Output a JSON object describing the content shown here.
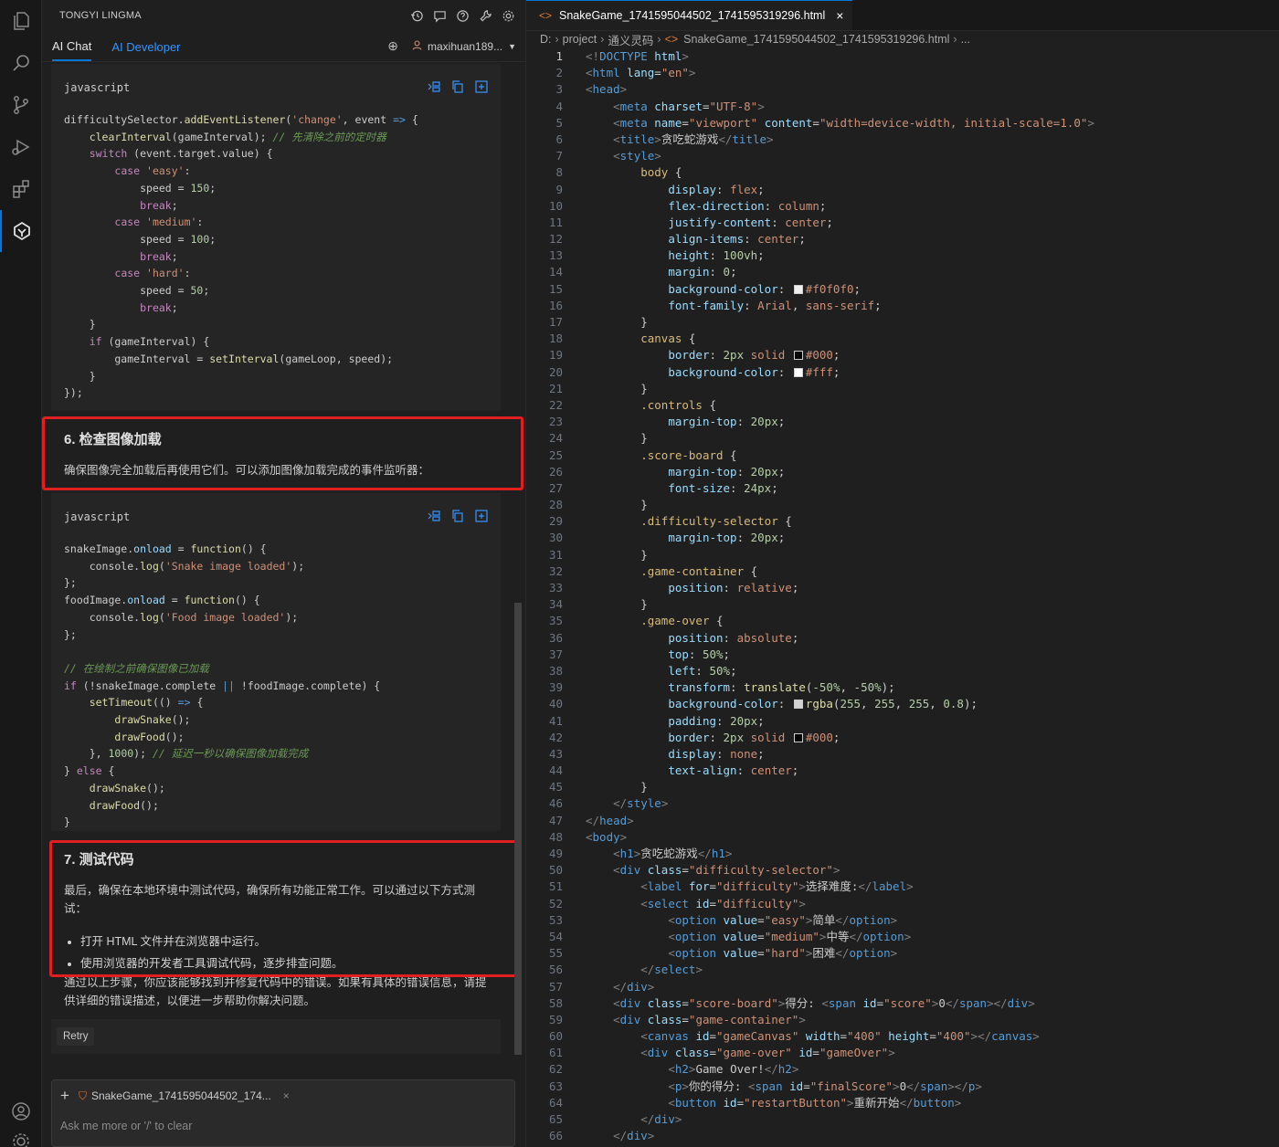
{
  "app": {
    "title": "TONGYI LINGMA"
  },
  "panel": {
    "tabs": [
      {
        "label": "AI Chat"
      },
      {
        "label": "AI Developer"
      }
    ],
    "user": "maxihuan189..."
  },
  "chat": {
    "code1_lang": "javascript",
    "section6": {
      "title": "6. 检查图像加载",
      "text": "确保图像完全加载后再使用它们。可以添加图像加载完成的事件监听器："
    },
    "code2_lang": "javascript",
    "section7": {
      "title": "7. 测试代码",
      "text": "最后，确保在本地环境中测试代码，确保所有功能正常工作。可以通过以下方式测试：",
      "bullets": [
        "打开 HTML 文件并在浏览器中运行。",
        "使用浏览器的开发者工具调试代码，逐步排查问题。"
      ]
    },
    "closing": "通过以上步骤，你应该能够找到并修复代码中的错误。如果有具体的错误信息，请提供详细的错误描述，以便进一步帮助你解决问题。",
    "retry": "Retry"
  },
  "input": {
    "chip": "SnakeGame_1741595044502_174...",
    "placeholder": "Ask me more or '/' to clear"
  },
  "editor": {
    "tab": "SnakeGame_1741595044502_1741595319296.html",
    "breadcrumb": [
      "D:",
      "project",
      "通义灵码",
      "SnakeGame_1741595044502_1741595319296.html",
      "..."
    ]
  },
  "colors": {
    "accent": "#0078d4",
    "highlight": "#e02020"
  },
  "icons": [
    "files-icon",
    "search-icon",
    "source-control-icon",
    "run-debug-icon",
    "extensions-icon",
    "lingma-icon",
    "account-icon",
    "settings-icon",
    "history-icon",
    "chat-bubble-icon",
    "help-icon",
    "wrench-icon",
    "gear-icon",
    "add-icon",
    "user-icon",
    "insert-icon",
    "copy-icon",
    "new-file-icon"
  ]
}
